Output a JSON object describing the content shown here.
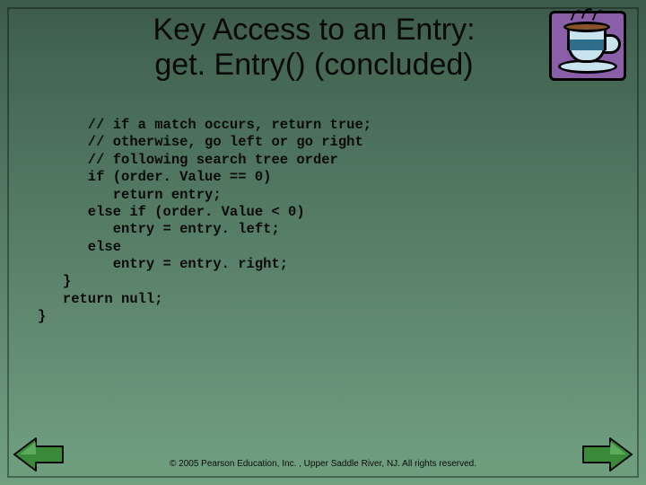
{
  "title": "Key Access to an Entry:\nget. Entry() (concluded)",
  "code": "      // if a match occurs, return true;\n      // otherwise, go left or go right\n      // following search tree order\n      if (order. Value == 0)\n         return entry;\n      else if (order. Value < 0)\n         entry = entry. left;\n      else\n         entry = entry. right;\n   }\n   return null;\n}",
  "footer": "© 2005 Pearson Education, Inc. , Upper Saddle River, NJ.  All rights reserved.",
  "icons": {
    "cup": "coffee-cup-icon",
    "prev": "prev-arrow-icon",
    "next": "next-arrow-icon"
  },
  "colors": {
    "arrow_fill": "#3a8a3a",
    "arrow_stroke": "#0a0a0a"
  }
}
